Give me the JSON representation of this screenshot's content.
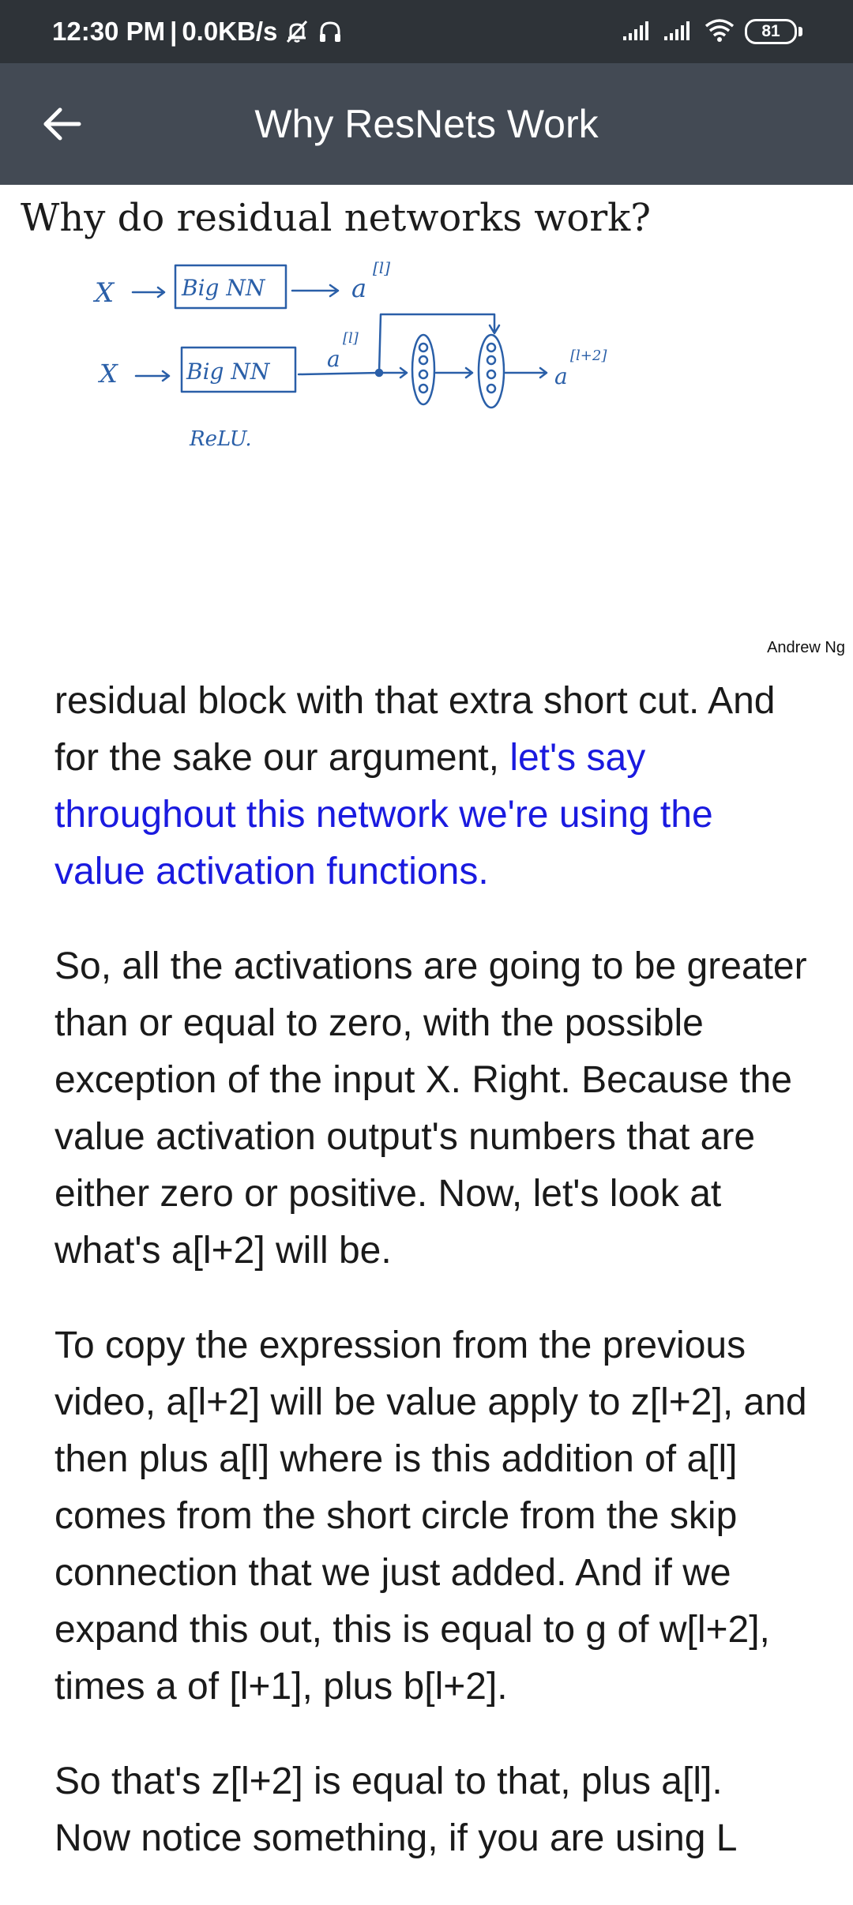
{
  "status_bar": {
    "time": "12:30 PM",
    "separator": "|",
    "network_speed": "0.0KB/s",
    "battery_level": "81",
    "icons": [
      "mute-icon",
      "headphones-icon",
      "signal-icon",
      "signal-icon",
      "wifi-icon",
      "battery-icon"
    ]
  },
  "app_bar": {
    "title": "Why ResNets Work",
    "back_icon": "arrow-left-icon"
  },
  "slide": {
    "title": "Why do residual networks work?",
    "credit": "Andrew Ng",
    "handwriting": {
      "x1": "X",
      "box1": "Big NN",
      "a1": "a",
      "sup1": "[l]",
      "x2": "X",
      "box2": "Big NN",
      "a2": "a",
      "sup2": "[l]",
      "a3": "a",
      "sup3": "[l+2]",
      "relu": "ReLU."
    },
    "ink_color": "#2a5fa8"
  },
  "transcript": {
    "highlight_color": "#1a1adf",
    "p1_before": "residual block with that extra short cut. And for the sake our argument, ",
    "p1_highlight": "let's say throughout this network we're using the value activation functions.",
    "p2": "So, all the activations are going to be greater than or equal to zero, with the possible exception of the input X. Right. Because the value activation output's numbers that are either zero or positive. Now, let's look at what's a[l+2] will be.",
    "p3": "To copy the expression from the previous video, a[l+2] will be value apply to z[l+2], and then plus a[l] where is this addition of a[l] comes from the short circle from the skip connection that we just added. And if we expand this out, this is equal to g of w[l+2], times a of [l+1], plus b[l+2].",
    "p4": "So that's z[l+2] is equal to that, plus a[l].",
    "p5_partial": "Now notice something, if you are using L"
  }
}
